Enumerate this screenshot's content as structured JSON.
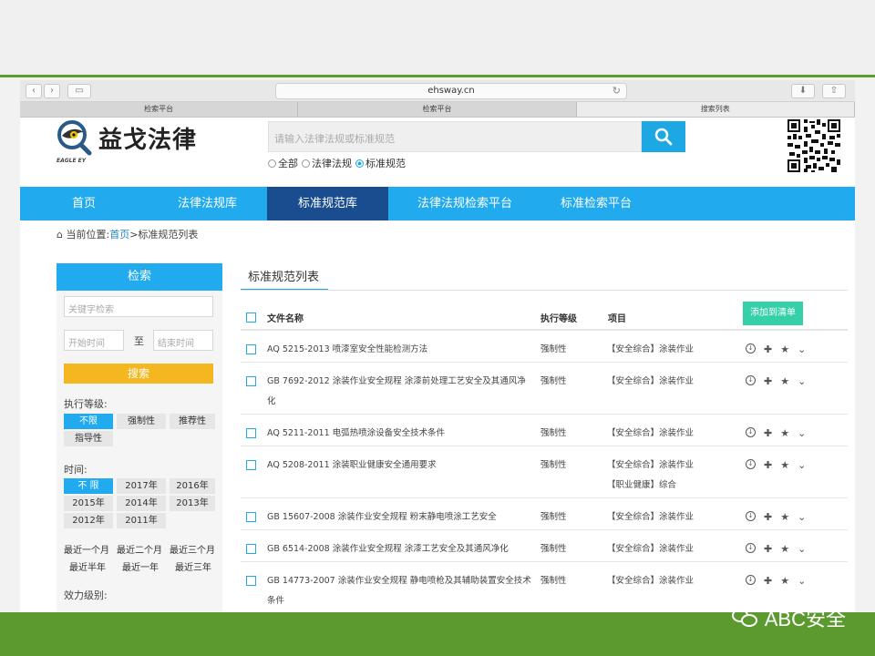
{
  "browser": {
    "url": "ehsway.cn",
    "tabs": [
      "检索平台",
      "检索平台",
      "搜索列表"
    ],
    "active_tab": 2
  },
  "header": {
    "logo_text": "益戈法律",
    "logo_sub": "EAGLE EY",
    "search_placeholder": "请输入法律法规或标准规范",
    "radios": [
      "全部",
      "法律法规",
      "标准规范"
    ],
    "radio_selected": 2
  },
  "nav": {
    "items": [
      "首页",
      "法律法规库",
      "标准规范库",
      "法律法规检索平台",
      "标准检索平台"
    ],
    "active": 2
  },
  "breadcrumb": {
    "prefix": "当前位置:",
    "home": "首页",
    "current": ">标准规范列表"
  },
  "sidebar": {
    "title": "检索",
    "keyword_placeholder": "关键字检索",
    "start_placeholder": "开始时间",
    "to_label": "至",
    "end_placeholder": "结束时间",
    "search_button": "搜索",
    "level_label": "执行等级:",
    "levels": [
      "不限",
      "强制性",
      "推荐性",
      "指导性"
    ],
    "time_label": "时间:",
    "years": [
      "不 限",
      "2017年",
      "2016年",
      "2015年",
      "2014年",
      "2013年",
      "2012年",
      "2011年"
    ],
    "periods": [
      "最近一个月",
      "最近二个月",
      "最近三个月",
      "最近半年",
      "最近一年",
      "最近三年"
    ],
    "effect_label": "效力级别:"
  },
  "main": {
    "title": "标准规范列表",
    "columns": {
      "name": "文件名称",
      "level": "执行等级",
      "project": "项目"
    },
    "add_button": "添加到清单",
    "rows": [
      {
        "name": "AQ 5215-2013 喷漆室安全性能检测方法",
        "level": "强制性",
        "project": [
          "【安全综合】涂装作业"
        ]
      },
      {
        "name": "GB 7692-2012 涂装作业安全规程 涂漆前处理工艺安全及其通风净化",
        "level": "强制性",
        "project": [
          "【安全综合】涂装作业"
        ]
      },
      {
        "name": "AQ 5211-2011 电弧热喷涂设备安全技术条件",
        "level": "强制性",
        "project": [
          "【安全综合】涂装作业"
        ]
      },
      {
        "name": "AQ 5208-2011 涂装职业健康安全通用要求",
        "level": "强制性",
        "project": [
          "【安全综合】涂装作业",
          "【职业健康】综合"
        ]
      },
      {
        "name": "GB 15607-2008 涂装作业安全规程 粉末静电喷涂工艺安全",
        "level": "强制性",
        "project": [
          "【安全综合】涂装作业"
        ]
      },
      {
        "name": "GB 6514-2008 涂装作业安全规程 涂漆工艺安全及其通风净化",
        "level": "强制性",
        "project": [
          "【安全综合】涂装作业"
        ]
      },
      {
        "name": "GB 14773-2007 涂装作业安全规程 静电喷枪及其辅助装置安全技术条件",
        "level": "强制性",
        "project": [
          "【安全综合】涂装作业"
        ]
      }
    ]
  },
  "watermark": {
    "text": "ABC安全",
    "icon": "wechat-icon"
  },
  "colors": {
    "accent": "#21aaed",
    "nav_active": "#1a4d8f",
    "search_button": "#f5b71f",
    "add_button": "#35cfa8",
    "band_green": "#5a9a2e"
  }
}
